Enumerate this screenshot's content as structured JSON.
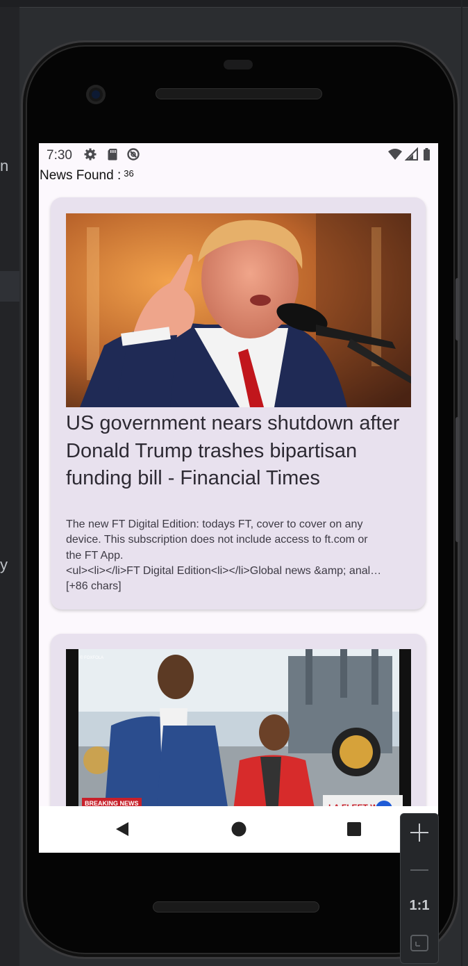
{
  "ide": {
    "left_letters": [
      "n",
      "y"
    ]
  },
  "status_bar": {
    "time": "7:30",
    "icons": [
      "gear-icon",
      "sd-card-icon",
      "data-saver-icon",
      "wifi-icon",
      "cellular-icon",
      "battery-icon"
    ]
  },
  "header": {
    "label": "News Found :",
    "count": "36"
  },
  "articles": [
    {
      "image": "photo-man-speaking-at-microphone",
      "title": "US government nears shutdown after Donald Trump trashes bipartisan funding bill - Financial Times",
      "description_lines": [
        "The new FT Digital Edition: todays FT, cover to cover on any",
        "device. This subscription does not include access to ft.com or",
        "the FT App.",
        "<ul><li></li>FT Digital Edition<li></li>Global news &amp; anal…",
        "[+86 chars]"
      ]
    },
    {
      "image": "photo-two-people-near-ship",
      "badge": "BREAKING NEWS",
      "watermark": "© FOXFOLA",
      "overlay_text": "LA FLEET W"
    }
  ],
  "nav_bar": {
    "buttons": [
      "back-icon",
      "home-icon",
      "recents-icon"
    ]
  },
  "zoom_controls": {
    "reset_label": "1:1"
  },
  "colors": {
    "card_background": "#e8e1ee",
    "screen_background": "#fcf8fd",
    "ide_background": "#2b2d30",
    "badge_red": "#c8202a"
  }
}
